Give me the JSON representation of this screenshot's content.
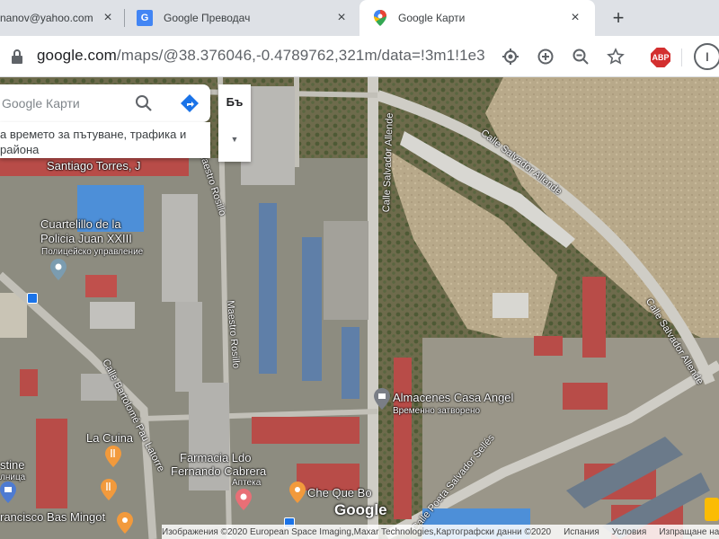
{
  "browser": {
    "tabs": [
      {
        "label": "nanov@yahoo.com - Ya",
        "active": false
      },
      {
        "label": "Google Преводач",
        "active": false
      },
      {
        "label": "Google Карти",
        "active": true
      }
    ],
    "new_tab": "+",
    "url_host": "google.com",
    "url_path": "/maps/@38.376046,-0.4789762,321m/data=!3m1!1e3",
    "abp_label": "ABP",
    "profile_initial": "I"
  },
  "maps": {
    "search_placeholder": "Google Карти",
    "info_line1": "а времето за пътуване, трафика и",
    "info_line2": "района",
    "layer_button": "Бъ",
    "labels": {
      "santiago": "Santiago Torres, J",
      "cuartelillo1": "Cuartelillo de la",
      "cuartelillo2": "Policia Juan XXIII",
      "police_bg": "Полицейско управление",
      "maestro_rosillo_top": "Maestro Rosillo",
      "maestro_rosillo_mid": "Maestro Rosillo",
      "calle_salvador_allende_v": "Calle Salvador Allende",
      "calle_salvador_allende_top": "Calle Salvador Allende",
      "calle_salvador_allende_right": "Calle Salvador Allende",
      "calle_bartolome": "Calle Bartolomé Pau Latorre",
      "almacenes": "Almacenes Casa Angel",
      "almacenes_status": "Временно затворено",
      "la_cuina": "La Cuina",
      "farmacia1": "Farmacia Ldo",
      "farmacia2": "Fernando Cabrera",
      "farmacia_bg": "Аптека",
      "che_que_bo": "Che Que Bo",
      "stine": "stine",
      "lnica": "лница",
      "bas_mingot": "rancisco Bas Mingot",
      "poeta_salvador": "Calle Poeta Salvador Sellés"
    },
    "google_logo": "Google",
    "footer": {
      "attribution": "Изображения ©2020 European Space Imaging,Maxar Technologies,Картографски данни ©2020",
      "country": "Испания",
      "terms": "Условия",
      "feedback": "Изпращане на отзи"
    }
  }
}
